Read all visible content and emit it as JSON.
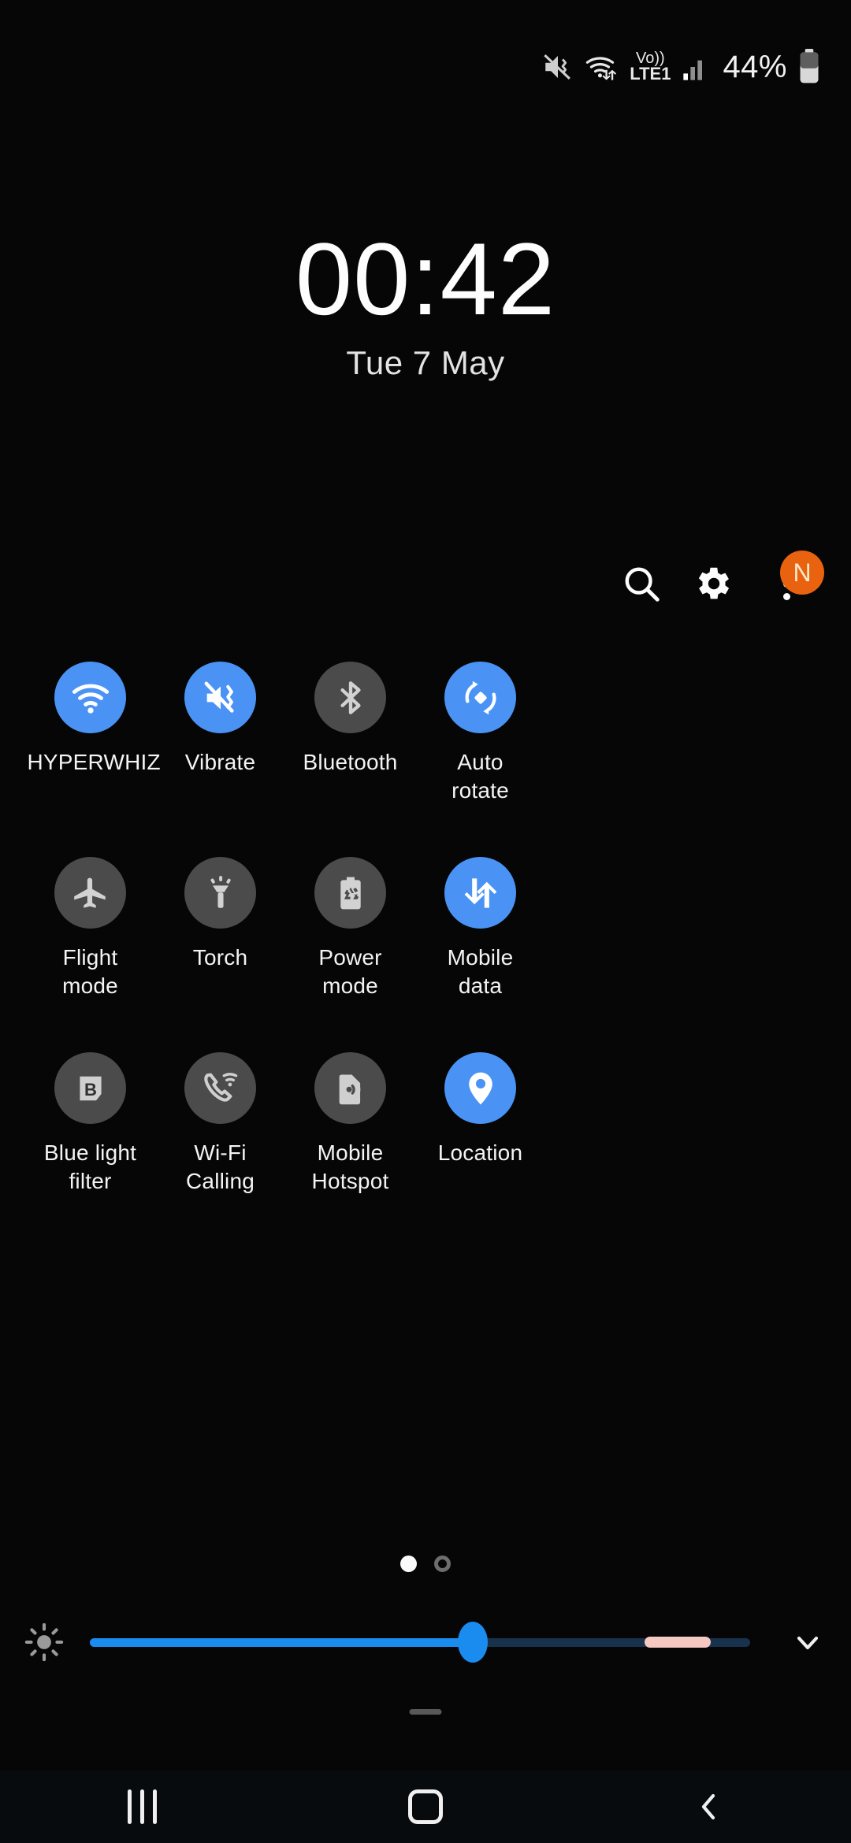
{
  "statusbar": {
    "icons": [
      "vibrate-icon",
      "wifi-data-icon",
      "volte-icon",
      "signal-bars-icon"
    ],
    "volte_top": "Vo))",
    "volte_bottom": "LTE1",
    "battery_percent": "44%",
    "battery_icon": "battery-icon"
  },
  "clock": {
    "time": "00:42",
    "date": "Tue 7 May"
  },
  "actions": [
    {
      "name": "search-icon",
      "label": "Search"
    },
    {
      "name": "gear-icon",
      "label": "Settings"
    },
    {
      "name": "overflow-menu-icon",
      "label": "More options",
      "badge": "N"
    }
  ],
  "tiles": [
    {
      "label": "HYPERWHIZ",
      "icon": "wifi-icon",
      "active": true
    },
    {
      "label": "Vibrate",
      "icon": "vibrate-icon",
      "active": true
    },
    {
      "label": "Bluetooth",
      "icon": "bluetooth-icon",
      "active": false
    },
    {
      "label": "Auto\nrotate",
      "icon": "auto-rotate-icon",
      "active": true
    },
    {
      "label": "Flight\nmode",
      "icon": "airplane-icon",
      "active": false
    },
    {
      "label": "Torch",
      "icon": "flashlight-icon",
      "active": false
    },
    {
      "label": "Power\nmode",
      "icon": "power-mode-icon",
      "active": false
    },
    {
      "label": "Mobile\ndata",
      "icon": "mobile-data-icon",
      "active": true
    },
    {
      "label": "Blue light\nfilter",
      "icon": "blue-light-icon",
      "active": false
    },
    {
      "label": "Wi-Fi Calling",
      "icon": "wifi-calling-icon",
      "active": false
    },
    {
      "label": "Mobile\nHotspot",
      "icon": "hotspot-icon",
      "active": false
    },
    {
      "label": "Location",
      "icon": "location-pin-icon",
      "active": true
    }
  ],
  "pager": {
    "count": 2,
    "active_index": 0
  },
  "brightness": {
    "icon": "brightness-sun-icon",
    "value_percent": 58,
    "marker_percent": 92,
    "expand_icon": "chevron-down-icon"
  },
  "navbar": {
    "recents_label": "Recents",
    "home_label": "Home",
    "back_label": "Back"
  },
  "colors": {
    "accent_blue": "#4a93f5",
    "inactive_gray": "#4b4b4b",
    "badge_orange": "#e8620f",
    "slider_blue": "#1a8cf0",
    "slider_marker_pink": "#f6c8c2",
    "background": "#060606"
  }
}
